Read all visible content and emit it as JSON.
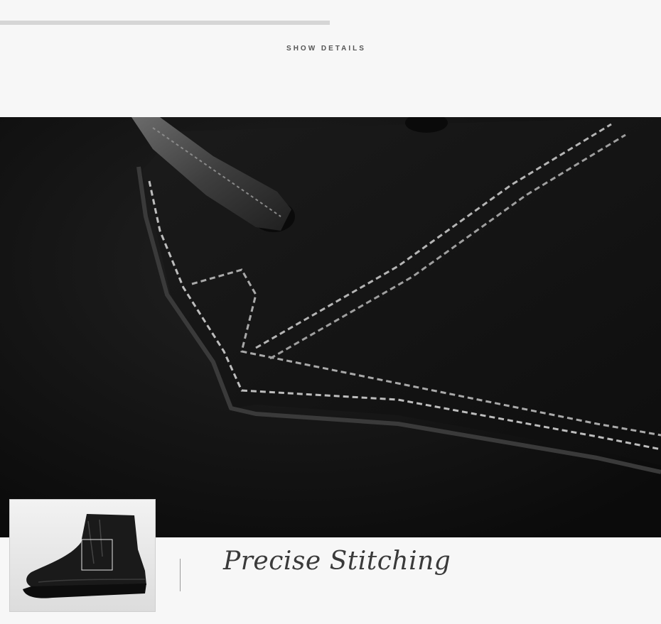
{
  "header": {
    "section_label": "SHOW DETAILS"
  },
  "hero": {
    "subject": "suede leather with double stitching and braided lace"
  },
  "thumbnail": {
    "subject": "black suede brogue ankle boot",
    "highlight": "stitching detail box"
  },
  "caption": {
    "title": "Precise Stitching"
  },
  "colors": {
    "background": "#f7f7f7",
    "suede": "#121212",
    "stitch": "#bdbdbd",
    "caption_text": "#3a3a3a"
  }
}
